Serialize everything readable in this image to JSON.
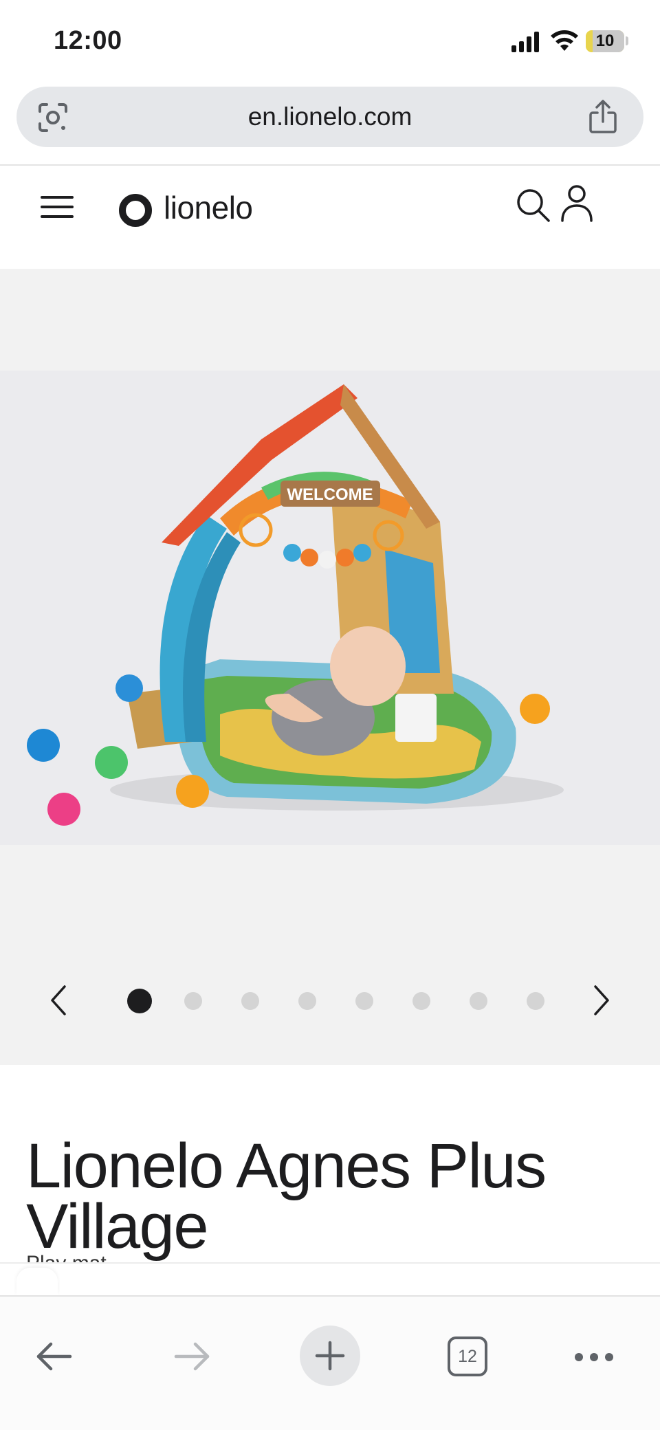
{
  "status_bar": {
    "time": "12:00",
    "battery": "10",
    "icons": [
      "signal-icon",
      "wifi-icon",
      "battery-icon"
    ]
  },
  "browser": {
    "url": "en.lionelo.com",
    "icons": [
      "lens-icon",
      "share-icon"
    ]
  },
  "site_header": {
    "logo_text": "lionelo",
    "icons": [
      "hamburger-icon",
      "search-icon",
      "account-icon"
    ]
  },
  "gallery": {
    "image_count": 8,
    "active_index": 0,
    "image_alt": "Lionelo Agnes Plus Village play mat with baby",
    "sign_text": "WELCOME"
  },
  "product": {
    "title": "Lionelo Agnes Plus Village",
    "subtitle": "Play mat"
  },
  "toolbar": {
    "tabs_count": "12",
    "icons": [
      "back-arrow-icon",
      "forward-arrow-icon",
      "plus-icon",
      "tabs-icon",
      "more-icon"
    ]
  },
  "colors": {
    "accent_dark": "#1d1d1f",
    "battery_fill": "#e8d44d",
    "url_bar_bg": "#e5e7ea",
    "gallery_bg": "#f2f2f2"
  }
}
